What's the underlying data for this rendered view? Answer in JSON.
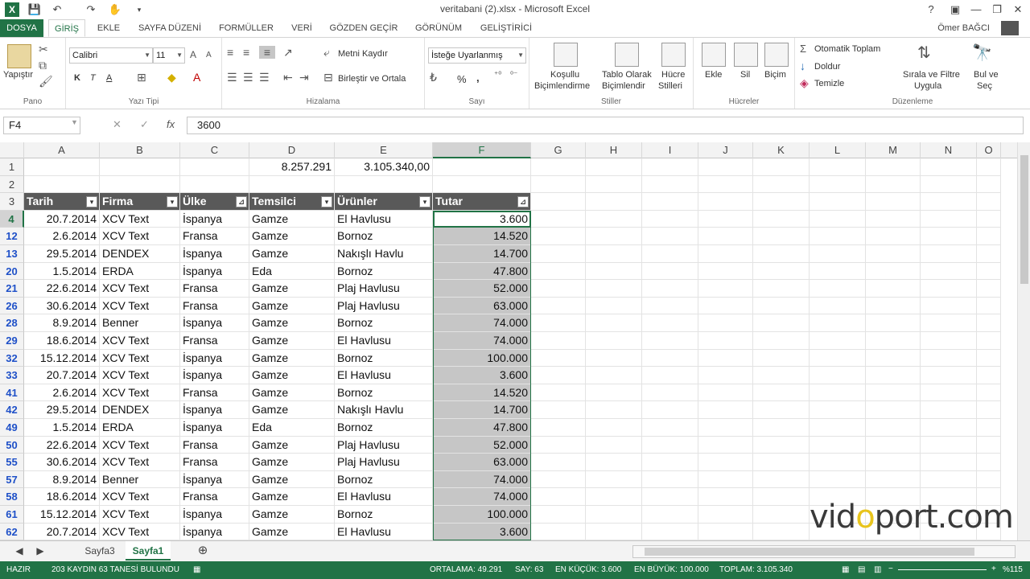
{
  "window": {
    "title": "veritabani (2).xlsx - Microsoft Excel"
  },
  "tabs": {
    "file": "DOSYA",
    "items": [
      "GİRİŞ",
      "EKLE",
      "SAYFA DÜZENİ",
      "FORMÜLLER",
      "VERİ",
      "GÖZDEN GEÇİR",
      "GÖRÜNÜM",
      "GELİŞTİRİCİ"
    ],
    "active": "GİRİŞ",
    "user": "Ömer BAĞCI"
  },
  "ribbon": {
    "pano": {
      "label": "Pano",
      "paste": "Yapıştır"
    },
    "font": {
      "label": "Yazı Tipi",
      "name": "Calibri",
      "size": "11",
      "bold": "K",
      "italic": "T",
      "underline": "A"
    },
    "align": {
      "label": "Hizalama",
      "wrap": "Metni Kaydır",
      "merge": "Birleştir ve Ortala"
    },
    "number": {
      "label": "Sayı",
      "format": "İsteğe Uyarlanmış",
      "percent": "%",
      "comma": ","
    },
    "styles": {
      "label": "Stiller",
      "cond1": "Koşullu",
      "cond2": "Biçimlendirme",
      "table1": "Tablo Olarak",
      "table2": "Biçimlendir",
      "cell1": "Hücre",
      "cell2": "Stilleri"
    },
    "cells": {
      "label": "Hücreler",
      "insert": "Ekle",
      "delete": "Sil",
      "format": "Biçim"
    },
    "editing": {
      "label": "Düzenleme",
      "autosum": "Otomatik Toplam",
      "fill": "Doldur",
      "clear": "Temizle",
      "sort1": "Sırala ve Filtre",
      "sort2": "Uygula",
      "find1": "Bul ve",
      "find2": "Seç"
    }
  },
  "formula_bar": {
    "name_box": "F4",
    "fx": "fx",
    "value": "3600"
  },
  "columns": [
    "A",
    "B",
    "C",
    "D",
    "E",
    "F",
    "G",
    "H",
    "I",
    "J",
    "K",
    "L",
    "M",
    "N",
    "O"
  ],
  "row1": {
    "rownum": "1",
    "d": "8.257.291",
    "e": "3.105.340,00"
  },
  "row2": {
    "rownum": "2"
  },
  "header": {
    "rownum": "3",
    "cols": [
      "Tarih",
      "Firma",
      "Ülke",
      "Temsilci",
      "Ürünler",
      "Tutar"
    ]
  },
  "rows": [
    {
      "n": "4",
      "tarih": "20.7.2014",
      "firma": "XCV Text",
      "ulke": "İspanya",
      "temsilci": "Gamze",
      "urun": "El Havlusu",
      "tutar": "3.600"
    },
    {
      "n": "12",
      "tarih": "2.6.2014",
      "firma": "XCV Text",
      "ulke": "Fransa",
      "temsilci": "Gamze",
      "urun": "Bornoz",
      "tutar": "14.520"
    },
    {
      "n": "13",
      "tarih": "29.5.2014",
      "firma": "DENDEX",
      "ulke": "İspanya",
      "temsilci": "Gamze",
      "urun": "Nakışlı Havlu",
      "tutar": "14.700"
    },
    {
      "n": "20",
      "tarih": "1.5.2014",
      "firma": "ERDA",
      "ulke": "İspanya",
      "temsilci": "Eda",
      "urun": "Bornoz",
      "tutar": "47.800"
    },
    {
      "n": "21",
      "tarih": "22.6.2014",
      "firma": "XCV Text",
      "ulke": "Fransa",
      "temsilci": "Gamze",
      "urun": "Plaj Havlusu",
      "tutar": "52.000"
    },
    {
      "n": "26",
      "tarih": "30.6.2014",
      "firma": "XCV Text",
      "ulke": "Fransa",
      "temsilci": "Gamze",
      "urun": "Plaj Havlusu",
      "tutar": "63.000"
    },
    {
      "n": "28",
      "tarih": "8.9.2014",
      "firma": "Benner",
      "ulke": "İspanya",
      "temsilci": "Gamze",
      "urun": "Bornoz",
      "tutar": "74.000"
    },
    {
      "n": "29",
      "tarih": "18.6.2014",
      "firma": "XCV Text",
      "ulke": "Fransa",
      "temsilci": "Gamze",
      "urun": "El Havlusu",
      "tutar": "74.000"
    },
    {
      "n": "32",
      "tarih": "15.12.2014",
      "firma": "XCV Text",
      "ulke": "İspanya",
      "temsilci": "Gamze",
      "urun": "Bornoz",
      "tutar": "100.000"
    },
    {
      "n": "33",
      "tarih": "20.7.2014",
      "firma": "XCV Text",
      "ulke": "İspanya",
      "temsilci": "Gamze",
      "urun": "El Havlusu",
      "tutar": "3.600"
    },
    {
      "n": "41",
      "tarih": "2.6.2014",
      "firma": "XCV Text",
      "ulke": "Fransa",
      "temsilci": "Gamze",
      "urun": "Bornoz",
      "tutar": "14.520"
    },
    {
      "n": "42",
      "tarih": "29.5.2014",
      "firma": "DENDEX",
      "ulke": "İspanya",
      "temsilci": "Gamze",
      "urun": "Nakışlı Havlu",
      "tutar": "14.700"
    },
    {
      "n": "49",
      "tarih": "1.5.2014",
      "firma": "ERDA",
      "ulke": "İspanya",
      "temsilci": "Eda",
      "urun": "Bornoz",
      "tutar": "47.800"
    },
    {
      "n": "50",
      "tarih": "22.6.2014",
      "firma": "XCV Text",
      "ulke": "Fransa",
      "temsilci": "Gamze",
      "urun": "Plaj Havlusu",
      "tutar": "52.000"
    },
    {
      "n": "55",
      "tarih": "30.6.2014",
      "firma": "XCV Text",
      "ulke": "Fransa",
      "temsilci": "Gamze",
      "urun": "Plaj Havlusu",
      "tutar": "63.000"
    },
    {
      "n": "57",
      "tarih": "8.9.2014",
      "firma": "Benner",
      "ulke": "İspanya",
      "temsilci": "Gamze",
      "urun": "Bornoz",
      "tutar": "74.000"
    },
    {
      "n": "58",
      "tarih": "18.6.2014",
      "firma": "XCV Text",
      "ulke": "Fransa",
      "temsilci": "Gamze",
      "urun": "El Havlusu",
      "tutar": "74.000"
    },
    {
      "n": "61",
      "tarih": "15.12.2014",
      "firma": "XCV Text",
      "ulke": "İspanya",
      "temsilci": "Gamze",
      "urun": "Bornoz",
      "tutar": "100.000"
    },
    {
      "n": "62",
      "tarih": "20.7.2014",
      "firma": "XCV Text",
      "ulke": "İspanya",
      "temsilci": "Gamze",
      "urun": "El Havlusu",
      "tutar": "3.600"
    }
  ],
  "sheets": [
    "Sayfa3",
    "Sayfa1"
  ],
  "active_sheet": "Sayfa1",
  "status": {
    "mode": "HAZIR",
    "filter": "203 KAYDIN 63 TANESİ BULUNDU",
    "average": "ORTALAMA: 49.291",
    "count": "SAY: 63",
    "min": "EN KÜÇÜK: 3.600",
    "max": "EN BÜYÜK: 100.000",
    "sum": "TOPLAM: 3.105.340",
    "zoom": "%115"
  },
  "watermark": {
    "a": "vid",
    "o": "o",
    "b": "port.com"
  },
  "colors": {
    "accent": "#217346",
    "header_fill": "#595959",
    "filtered_rownum": "#1e50c8"
  }
}
